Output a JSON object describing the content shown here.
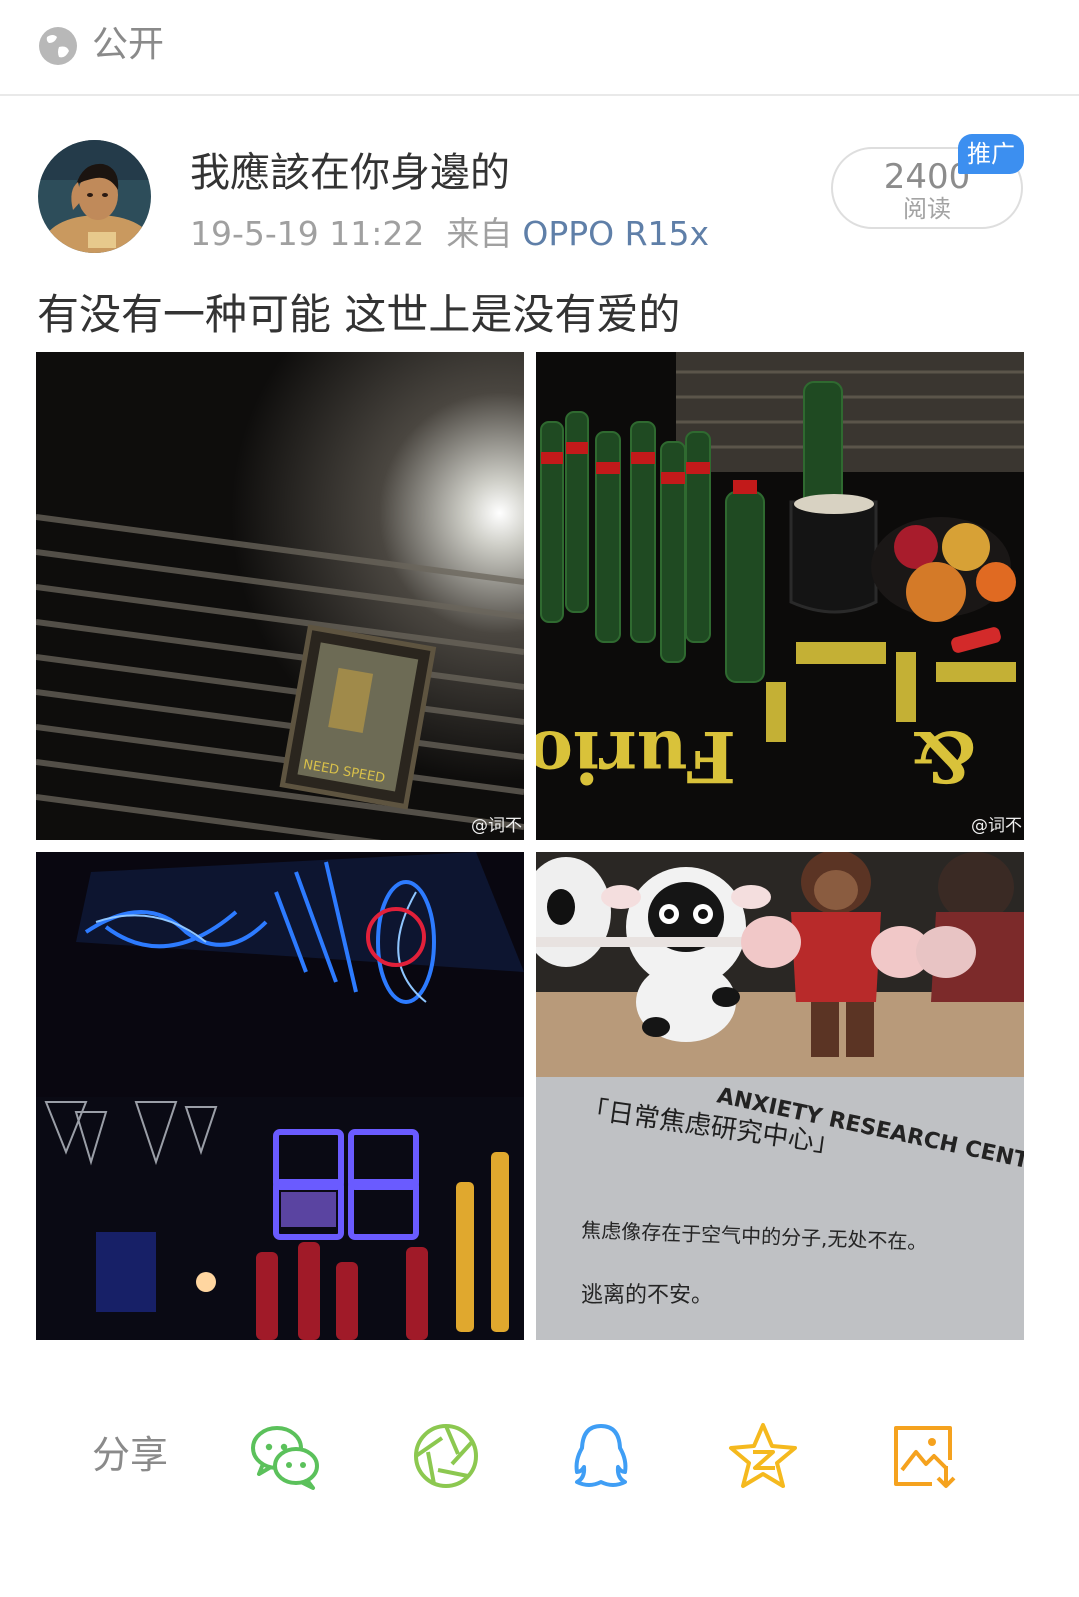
{
  "header": {
    "visibility_label": "公开",
    "visibility_icon": "globe-icon"
  },
  "post": {
    "author": "我應該在你身邊的",
    "date": "19-5-19 11:22",
    "from_label": "来自",
    "device": "OPPO R15x",
    "read_count": "2400",
    "read_label": "阅读",
    "promo_badge": "推广",
    "text": "有没有一种可能 这世上是没有爱的",
    "photos": [
      {
        "name": "photo-room-wall",
        "watermark": "@词不"
      },
      {
        "name": "photo-table-drinks",
        "watermark": "@词不",
        "text": "Furious"
      },
      {
        "name": "photo-neon-bar"
      },
      {
        "name": "photo-plush-anxiety",
        "text": "ANXIETY RESEARCH CENTER",
        "sign_title": "「日常焦虑研究中心」",
        "sign_body_1": "焦虑像存在于空气中的分子,无处不在。",
        "sign_body_2": "逃离的不安。"
      }
    ]
  },
  "share_bar": {
    "label": "分享",
    "icons": [
      "wechat-icon",
      "moments-icon",
      "qq-icon",
      "qzone-icon",
      "save-image-icon"
    ]
  },
  "colors": {
    "accent_blue": "#3c8ff0",
    "device_link": "#5f7fa8",
    "wechat_green": "#5bc15b",
    "moments_green": "#8cc850",
    "qq_blue": "#3f9ef5",
    "qzone_yellow": "#f5b91e",
    "save_orange": "#f5a21e"
  }
}
